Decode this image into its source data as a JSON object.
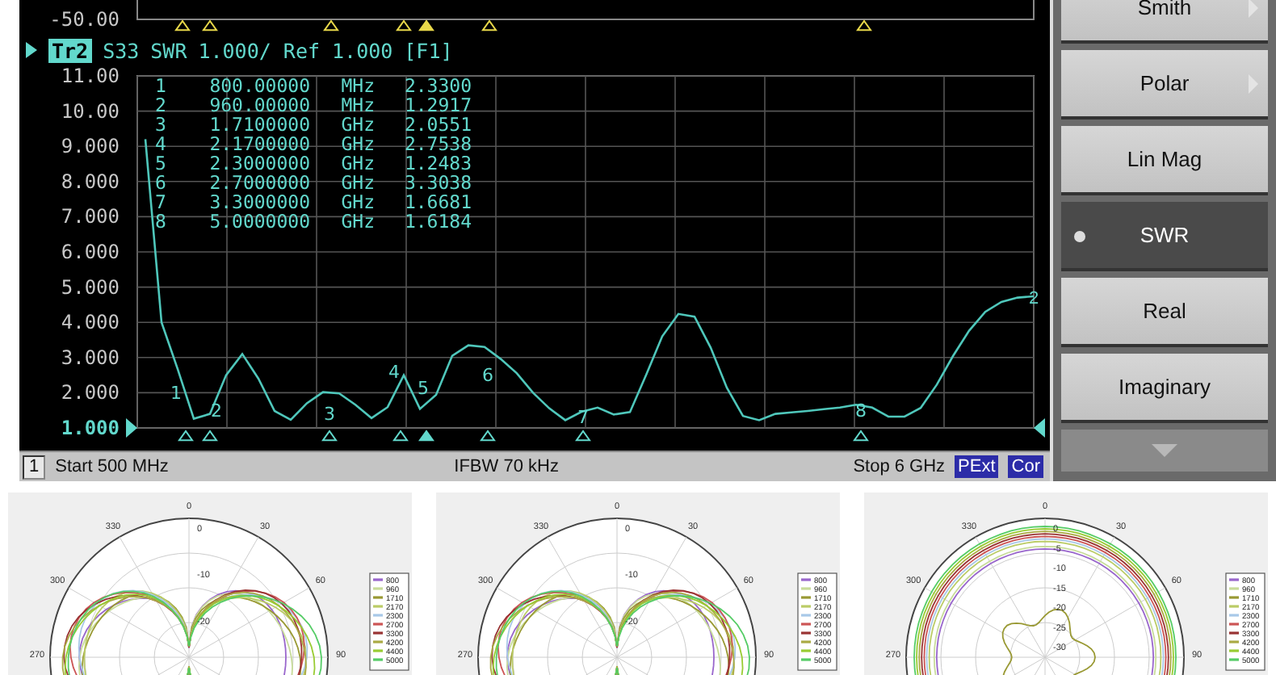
{
  "upper_trace": {
    "axis_label": "-50.00"
  },
  "trace_header": {
    "selected": true,
    "parameter": "S33",
    "format": "SWR",
    "scale": "1.000/ Ref 1.000",
    "function": "[F1]"
  },
  "chart_data": {
    "type": "line",
    "grid": true,
    "ylim": [
      1,
      11
    ],
    "yticks": [
      {
        "value": 11,
        "label": "11.00"
      },
      {
        "value": 10,
        "label": "10.00"
      },
      {
        "value": 9,
        "label": "9.000"
      },
      {
        "value": 8,
        "label": "8.000"
      },
      {
        "value": 7,
        "label": "7.000"
      },
      {
        "value": 6,
        "label": "6.000"
      },
      {
        "value": 5,
        "label": "5.000"
      },
      {
        "value": 4,
        "label": "4.000"
      },
      {
        "value": 3,
        "label": "3.000"
      },
      {
        "value": 2,
        "label": "2.000"
      },
      {
        "value": 1,
        "label": "1.000"
      }
    ],
    "categories": [
      null,
      null,
      null,
      null,
      null,
      null,
      null,
      null,
      null,
      null,
      null,
      null,
      null,
      null,
      null,
      null,
      null,
      null,
      null,
      null,
      null,
      null,
      null,
      null,
      null,
      null,
      null,
      null,
      null,
      null,
      null,
      null,
      null,
      null,
      null,
      null,
      null,
      null,
      null,
      null,
      null,
      null,
      null,
      null,
      null,
      null,
      null,
      null,
      null,
      null,
      null,
      null,
      null,
      null,
      null,
      null
    ],
    "series": [
      {
        "name": "Tr2",
        "color": "#4fc7bb",
        "values": [
          9.2,
          4.0,
          2.67,
          1.26,
          1.4,
          2.5,
          3.1,
          2.4,
          1.48,
          1.23,
          1.7,
          2.02,
          1.98,
          1.66,
          1.28,
          1.59,
          2.5,
          1.54,
          1.94,
          3.05,
          3.35,
          3.3,
          2.96,
          2.55,
          2.0,
          1.56,
          1.22,
          1.46,
          1.58,
          1.38,
          1.45,
          2.5,
          3.6,
          4.24,
          4.16,
          3.28,
          2.14,
          1.34,
          1.22,
          1.4,
          1.44,
          1.48,
          1.53,
          1.58,
          1.66,
          1.58,
          1.32,
          1.32,
          1.57,
          2.23,
          3.04,
          3.76,
          4.3,
          4.58,
          4.7,
          4.74
        ]
      }
    ]
  },
  "marker_table": [
    {
      "number": "1",
      "frequency": "800.00000",
      "unit": "MHz",
      "value": "2.3300"
    },
    {
      "number": "2",
      "frequency": "960.00000",
      "unit": "MHz",
      "value": "1.2917"
    },
    {
      "number": "3",
      "frequency": "1.7100000",
      "unit": "GHz",
      "value": "2.0551"
    },
    {
      "number": "4",
      "frequency": "2.1700000",
      "unit": "GHz",
      "value": "2.7538"
    },
    {
      "number": "5",
      "frequency": "2.3000000",
      "unit": "GHz",
      "value": "1.2483"
    },
    {
      "number": "6",
      "frequency": "2.7000000",
      "unit": "GHz",
      "value": "3.3038"
    },
    {
      "number": "7",
      "frequency": "3.3000000",
      "unit": "GHz",
      "value": "1.6681"
    },
    {
      "number": "8",
      "frequency": "5.0000000",
      "unit": "GHz",
      "value": "1.6184"
    }
  ],
  "trace_marker_labels": [
    "1",
    "2",
    "3",
    "4",
    "5",
    "6",
    "7",
    "8"
  ],
  "trace_end_label": "2",
  "status_bar": {
    "channel": "1",
    "start": "Start 500 MHz",
    "ifbw": "IFBW 70 kHz",
    "stop": "Stop 6 GHz",
    "badges": [
      "PExt",
      "Cor"
    ]
  },
  "softkeys": [
    {
      "label": "Smith",
      "submenu": true,
      "selected": false
    },
    {
      "label": "Polar",
      "submenu": true,
      "selected": false
    },
    {
      "label": "Lin Mag",
      "submenu": false,
      "selected": false
    },
    {
      "label": "SWR",
      "submenu": false,
      "selected": true
    },
    {
      "label": "Real",
      "submenu": false,
      "selected": false
    },
    {
      "label": "Imaginary",
      "submenu": false,
      "selected": false
    }
  ],
  "polar_plots": [
    {
      "kind": "lobes",
      "angle_labels": [
        "0",
        "30",
        "330",
        "60",
        "300",
        "90",
        "270"
      ],
      "radial_labels": [
        "0",
        "-10",
        "-20"
      ],
      "legend": [
        {
          "label": "800",
          "color": "#9966cc"
        },
        {
          "label": "960",
          "color": "#c8dc9a"
        },
        {
          "label": "1710",
          "color": "#999933"
        },
        {
          "label": "2170",
          "color": "#bbcc66"
        },
        {
          "label": "2300",
          "color": "#a8c8e8"
        },
        {
          "label": "2700",
          "color": "#cc5555"
        },
        {
          "label": "3300",
          "color": "#993333"
        },
        {
          "label": "4200",
          "color": "#aaaa44"
        },
        {
          "label": "4400",
          "color": "#99cc33"
        },
        {
          "label": "5000",
          "color": "#55cc66"
        }
      ]
    },
    {
      "kind": "lobes",
      "angle_labels": [
        "0",
        "30",
        "330",
        "60",
        "300",
        "90",
        "270"
      ],
      "radial_labels": [
        "0",
        "-10",
        "-20"
      ],
      "legend": [
        {
          "label": "800",
          "color": "#9966cc"
        },
        {
          "label": "960",
          "color": "#c8dc9a"
        },
        {
          "label": "1710",
          "color": "#999933"
        },
        {
          "label": "2170",
          "color": "#bbcc66"
        },
        {
          "label": "2300",
          "color": "#a8c8e8"
        },
        {
          "label": "2700",
          "color": "#cc5555"
        },
        {
          "label": "3300",
          "color": "#993333"
        },
        {
          "label": "4200",
          "color": "#aaaa44"
        },
        {
          "label": "4400",
          "color": "#99cc33"
        },
        {
          "label": "5000",
          "color": "#55cc66"
        }
      ]
    },
    {
      "kind": "omni",
      "angle_labels": [
        "0",
        "30",
        "330",
        "60",
        "300",
        "90",
        "270"
      ],
      "radial_labels": [
        "0",
        "-5",
        "-10",
        "-15",
        "-20",
        "-25",
        "-30"
      ],
      "legend": [
        {
          "label": "800",
          "color": "#9966cc"
        },
        {
          "label": "960",
          "color": "#c8dc9a"
        },
        {
          "label": "1710",
          "color": "#999933"
        },
        {
          "label": "2170",
          "color": "#bbcc66"
        },
        {
          "label": "2300",
          "color": "#a8c8e8"
        },
        {
          "label": "2700",
          "color": "#cc5555"
        },
        {
          "label": "3300",
          "color": "#993333"
        },
        {
          "label": "4200",
          "color": "#aaaa44"
        },
        {
          "label": "4400",
          "color": "#99cc33"
        },
        {
          "label": "5000",
          "color": "#55cc66"
        }
      ]
    }
  ]
}
